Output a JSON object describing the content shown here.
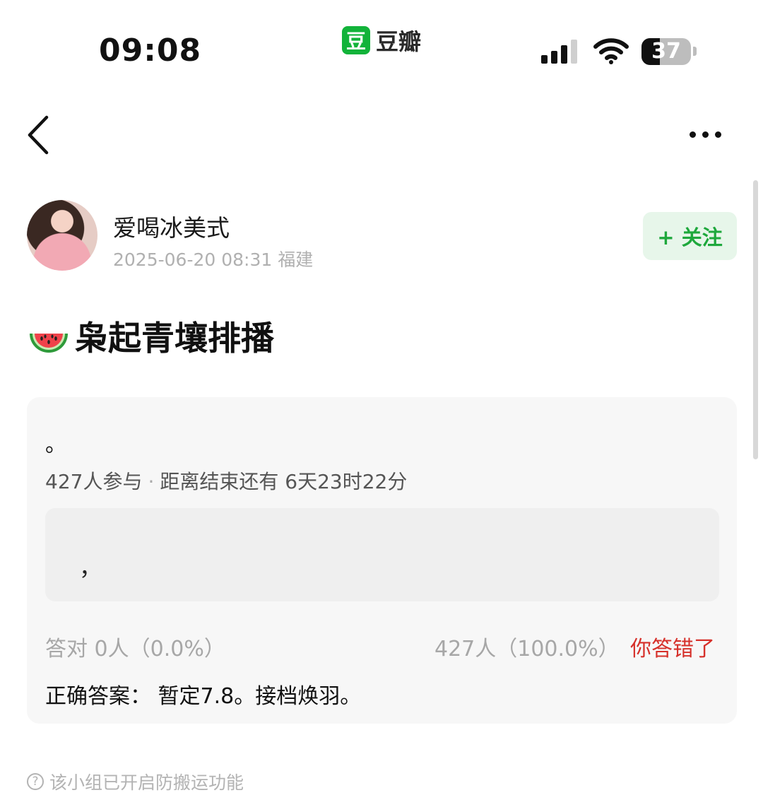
{
  "status_bar": {
    "time": "09:08",
    "app_logo_char": "豆",
    "app_name": "豆瓣",
    "battery": "37",
    "battery_level_percent": 37
  },
  "nav": {
    "back_icon": "chevron-left-icon",
    "more_icon": "more-horizontal-icon"
  },
  "author": {
    "name": "爱喝冰美式",
    "meta": "2025-06-20 08:31  福建",
    "follow_label": "+ 关注"
  },
  "post": {
    "title_icon": "watermelon-icon",
    "title": "枭起青壤排播"
  },
  "quiz": {
    "question": "。",
    "participants": "427人参与",
    "countdown": "距离结束还有 6天23时22分",
    "option_text": "，",
    "correct_stat": "答对  0人（0.0%）",
    "wrong_stat": "427人（100.0%）",
    "wrong_label": "你答错了",
    "answer": "正确答案：  暂定7.8。接档焕羽。"
  },
  "footer": {
    "notice": "该小组已开启防搬运功能"
  },
  "colors": {
    "brand_green": "#12b33a",
    "follow_bg": "#e7f6ea",
    "follow_text": "#1ea83c",
    "wrong_red": "#d6302a",
    "card_bg": "#f7f7f7"
  }
}
